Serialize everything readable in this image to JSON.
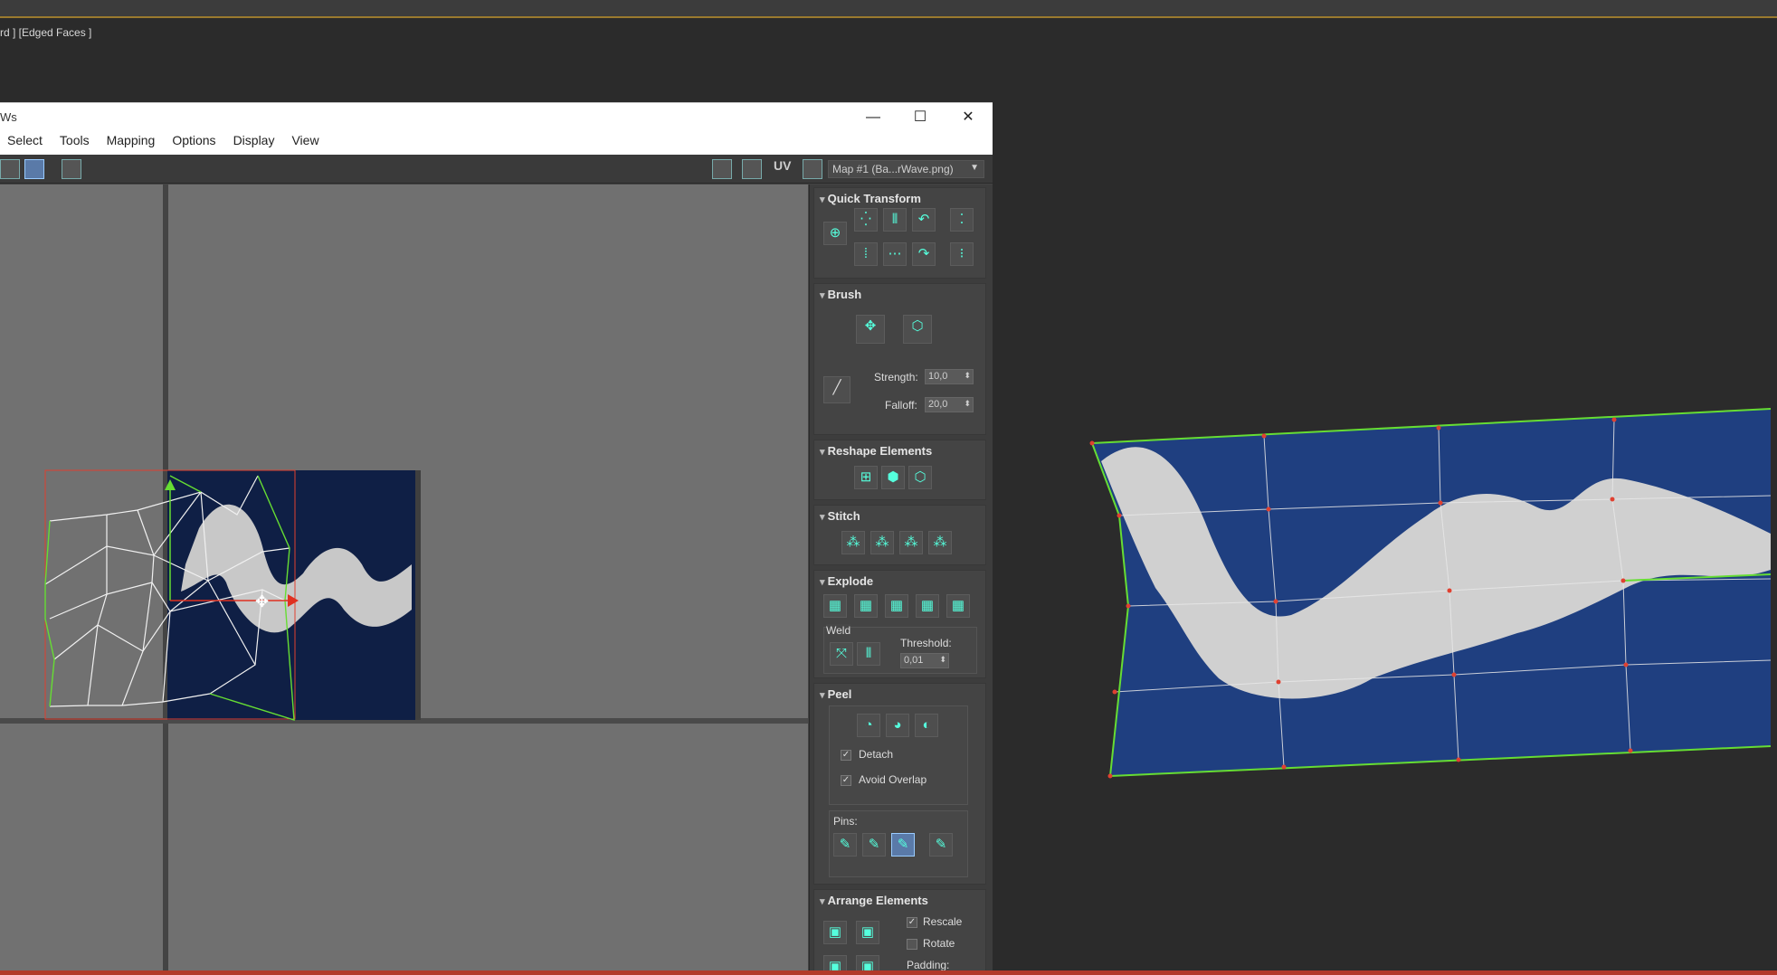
{
  "viewport_label": "rd ] [Edged Faces ]",
  "window": {
    "title": "Ws",
    "minimize": "—",
    "maximize": "☐",
    "close": "✕",
    "menu": [
      "Select",
      "Tools",
      "Mapping",
      "Options",
      "Display",
      "View"
    ]
  },
  "toolbar": {
    "uv_label": "UV",
    "map_dropdown": "Map #1 (Ba...rWave.png)",
    "dropdown_arrow": "▼"
  },
  "panel": {
    "quick_transform": {
      "title": "Quick Transform"
    },
    "brush": {
      "title": "Brush",
      "strength_label": "Strength:",
      "strength_value": "10,0",
      "falloff_label": "Falloff:",
      "falloff_value": "20,0"
    },
    "reshape": {
      "title": "Reshape Elements"
    },
    "stitch": {
      "title": "Stitch"
    },
    "explode": {
      "title": "Explode",
      "weld_label": "Weld",
      "threshold_label": "Threshold:",
      "threshold_value": "0,01"
    },
    "peel": {
      "title": "Peel",
      "detach_label": "Detach",
      "avoid_overlap_label": "Avoid Overlap",
      "pins_label": "Pins:"
    },
    "arrange": {
      "title": "Arrange Elements",
      "rescale_label": "Rescale",
      "rotate_label": "Rotate",
      "padding_label": "Padding:"
    }
  },
  "icons": {
    "checkmark": "✓",
    "spinner": "⬍"
  },
  "colors": {
    "uv_selection": "#e04030",
    "uv_edge_green": "#66dd33",
    "texture_blue": "#1f3f80",
    "texture_dark": "#0f1f45"
  }
}
